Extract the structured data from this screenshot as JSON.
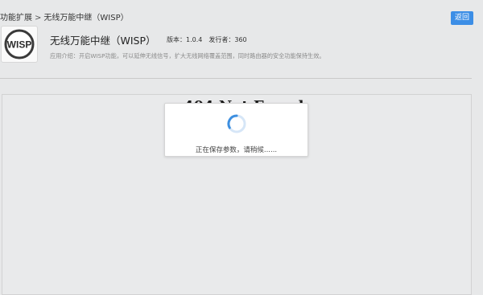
{
  "breadcrumb": {
    "parent": "功能扩展",
    "separator": ">",
    "current": "无线万能中继（WISP）"
  },
  "back_button": {
    "label": "返回"
  },
  "app": {
    "icon_name": "wisp-icon",
    "icon_text": "WISP",
    "title": "无线万能中继（WISP）",
    "version": "版本：1.0.4",
    "publisher": "发行者：360",
    "description": "应用介绍：开启WISP功能，可以延伸无线信号，扩大无线网络覆盖范围，同时路由器的安全功能保持生效。"
  },
  "content": {
    "behind_text": "404 Not Found"
  },
  "loading_dialog": {
    "spinner_icon": "spinner-icon",
    "message": "正在保存参数，请稍候......"
  },
  "colors": {
    "accent": "#3c8ee6",
    "spinner": "#3d8fe0",
    "background": "#e7e8e9"
  }
}
